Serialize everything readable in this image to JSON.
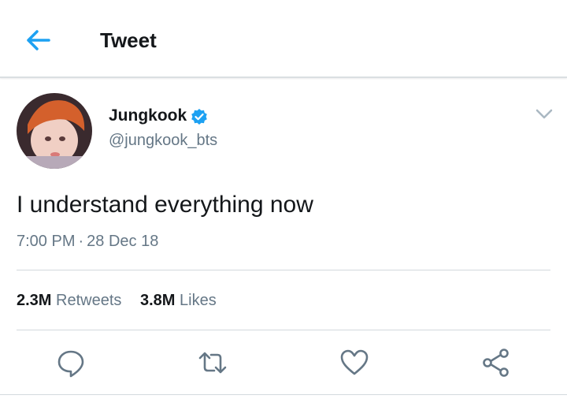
{
  "header": {
    "title": "Tweet",
    "back_icon": "back-arrow-icon",
    "accent": "#1da1f2"
  },
  "tweet": {
    "author_name": "Jungkook",
    "author_handle": "@jungkook_bts",
    "verified": true,
    "text": "I understand everything now",
    "time": "7:00 PM",
    "date": "28 Dec 18"
  },
  "stats": {
    "retweets_count": "2.3M",
    "retweets_label": "Retweets",
    "likes_count": "3.8M",
    "likes_label": "Likes"
  },
  "actions": [
    {
      "name": "reply",
      "icon": "reply-icon"
    },
    {
      "name": "retweet",
      "icon": "retweet-icon"
    },
    {
      "name": "like",
      "icon": "heart-icon"
    },
    {
      "name": "share",
      "icon": "share-icon"
    }
  ],
  "colors": {
    "text": "#14171a",
    "secondary": "#657786",
    "divider": "#d3d9dd",
    "verified": "#1da1f2"
  }
}
